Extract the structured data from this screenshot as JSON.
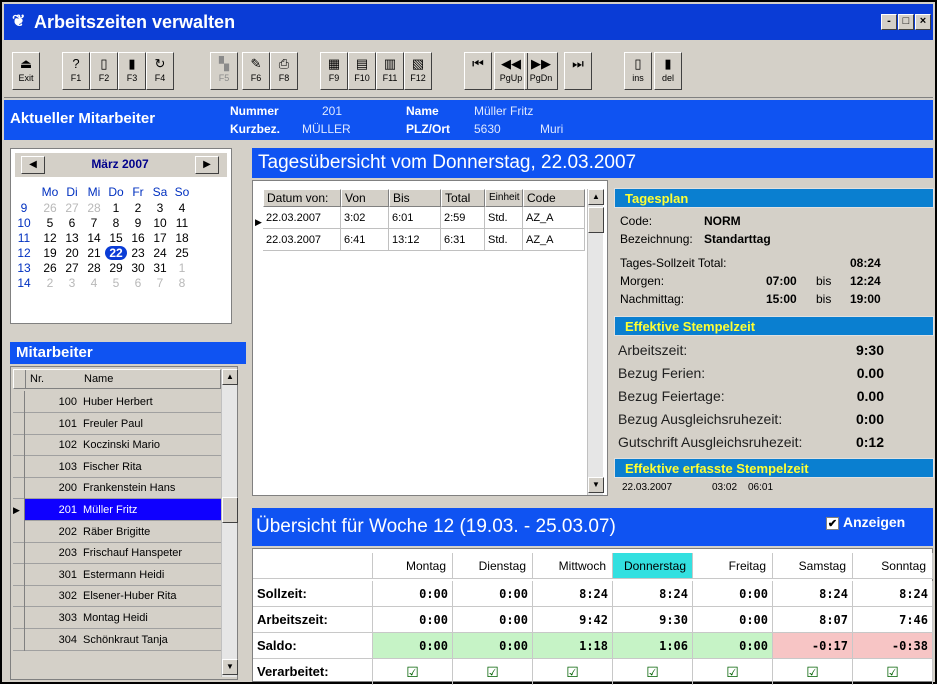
{
  "window": {
    "title": "Arbeitszeiten verwalten",
    "controls": [
      "-",
      "□",
      "×"
    ]
  },
  "toolbar": [
    {
      "icon": "exit-icon",
      "glyph": "⏏",
      "label": "Exit",
      "enabled": true
    },
    {
      "icon": "help-icon",
      "glyph": "?",
      "label": "F1",
      "enabled": true
    },
    {
      "icon": "new-icon",
      "glyph": "▯",
      "label": "F2",
      "enabled": true
    },
    {
      "icon": "delete-icon",
      "glyph": "▮",
      "label": "F3",
      "enabled": true
    },
    {
      "icon": "refresh-icon",
      "glyph": "↻",
      "label": "F4",
      "enabled": true
    },
    {
      "icon": "disabled-icon",
      "glyph": "▚",
      "label": "F5",
      "enabled": false
    },
    {
      "icon": "edit-icon",
      "glyph": "✎",
      "label": "F6",
      "enabled": true
    },
    {
      "icon": "print-icon",
      "glyph": "⎙",
      "label": "F8",
      "enabled": true
    },
    {
      "icon": "calendar-icon",
      "glyph": "▦",
      "label": "F9",
      "enabled": true
    },
    {
      "icon": "report-icon",
      "glyph": "▤",
      "label": "F10",
      "enabled": true
    },
    {
      "icon": "list-icon",
      "glyph": "▥",
      "label": "F11",
      "enabled": true
    },
    {
      "icon": "export-icon",
      "glyph": "▧",
      "label": "F12",
      "enabled": true
    },
    {
      "icon": "first-icon",
      "glyph": "⏮",
      "label": "",
      "enabled": true
    },
    {
      "icon": "prev-icon",
      "glyph": "◀◀",
      "label": "PgUp",
      "enabled": true
    },
    {
      "icon": "next-icon",
      "glyph": "▶▶",
      "label": "PgDn",
      "enabled": true
    },
    {
      "icon": "last-icon",
      "glyph": "⏭",
      "label": "",
      "enabled": true
    },
    {
      "icon": "insert-icon",
      "glyph": "▯",
      "label": "ins",
      "enabled": true
    },
    {
      "icon": "trash-icon",
      "glyph": "▮",
      "label": "del",
      "enabled": true
    }
  ],
  "employee_bar": {
    "title": "Aktueller Mitarbeiter",
    "nummer_label": "Nummer",
    "nummer_value": "201",
    "name_label": "Name",
    "name_value": "Müller Fritz",
    "kurzbez_label": "Kurzbez.",
    "kurzbez_value": "MÜLLER",
    "plz_label": "PLZ/Ort",
    "plz_value": "5630",
    "ort_value": "Muri"
  },
  "calendar": {
    "month": "März 2007",
    "prev": "◀",
    "next": "▶",
    "weekday_headers": [
      "Mo",
      "Di",
      "Mi",
      "Do",
      "Fr",
      "Sa",
      "So"
    ],
    "weeks": [
      {
        "wk": "9",
        "days": [
          "26",
          "27",
          "28",
          "1",
          "2",
          "3",
          "4"
        ]
      },
      {
        "wk": "10",
        "days": [
          "5",
          "6",
          "7",
          "8",
          "9",
          "10",
          "11"
        ]
      },
      {
        "wk": "11",
        "days": [
          "12",
          "13",
          "14",
          "15",
          "16",
          "17",
          "18"
        ]
      },
      {
        "wk": "12",
        "days": [
          "19",
          "20",
          "21",
          "22",
          "23",
          "24",
          "25"
        ]
      },
      {
        "wk": "13",
        "days": [
          "26",
          "27",
          "28",
          "29",
          "30",
          "31",
          "1"
        ]
      },
      {
        "wk": "14",
        "days": [
          "2",
          "3",
          "4",
          "5",
          "6",
          "7",
          "8"
        ]
      }
    ],
    "selected_day": "22"
  },
  "mitarbeiter": {
    "title": "Mitarbeiter",
    "col_nr": "Nr.",
    "col_name": "Name",
    "rows": [
      {
        "nr": "100",
        "name": "Huber Herbert"
      },
      {
        "nr": "101",
        "name": "Freuler Paul"
      },
      {
        "nr": "102",
        "name": "Koczinski Mario"
      },
      {
        "nr": "103",
        "name": "Fischer Rita"
      },
      {
        "nr": "200",
        "name": "Frankenstein Hans"
      },
      {
        "nr": "201",
        "name": "Müller Fritz"
      },
      {
        "nr": "202",
        "name": "Räber Brigitte"
      },
      {
        "nr": "203",
        "name": "Frischauf Hanspeter"
      },
      {
        "nr": "301",
        "name": "Estermann Heidi"
      },
      {
        "nr": "302",
        "name": "Elsener-Huber Rita"
      },
      {
        "nr": "303",
        "name": "Montag Heidi"
      },
      {
        "nr": "304",
        "name": "Schönkraut Tanja"
      }
    ],
    "selected_nr": "201"
  },
  "tagesuebersicht": {
    "title": "Tagesübersicht vom Donnerstag, 22.03.2007",
    "columns": [
      "Datum von:",
      "Von",
      "Bis",
      "Total",
      "Einheit",
      "Code"
    ],
    "rows": [
      [
        "22.03.2007",
        "3:02",
        "6:01",
        "2:59",
        "Std.",
        "AZ_A"
      ],
      [
        "22.03.2007",
        "6:41",
        "13:12",
        "6:31",
        "Std.",
        "AZ_A"
      ]
    ]
  },
  "tagesplan": {
    "title": "Tagesplan",
    "code_label": "Code:",
    "code_value": "NORM",
    "bez_label": "Bezeichnung:",
    "bez_value": "Standarttag",
    "soll_label": "Tages-Sollzeit Total:",
    "soll_value": "08:24",
    "morgen_label": "Morgen:",
    "morgen_from": "07:00",
    "morgen_bis": "bis",
    "morgen_to": "12:24",
    "nachm_label": "Nachmittag:",
    "nachm_from": "15:00",
    "nachm_bis": "bis",
    "nachm_to": "19:00"
  },
  "effektiv": {
    "title": "Effektive Stempelzeit",
    "rows": [
      {
        "label": "Arbeitszeit:",
        "value": "9:30"
      },
      {
        "label": "Bezug Ferien:",
        "value": "0.00"
      },
      {
        "label": "Bezug Feiertage:",
        "value": "0.00"
      },
      {
        "label": "Bezug Ausgleichsruhezeit:",
        "value": "0:00"
      },
      {
        "label": "Gutschrift Ausgleichsruhezeit:",
        "value": "0:12"
      }
    ]
  },
  "erfasst": {
    "title": "Effektive erfasste Stempelzeit",
    "date": "22.03.2007",
    "from": "03:02",
    "to": "06:01"
  },
  "woche": {
    "title": "Übersicht für Woche 12 (19.03. - 25.03.07)",
    "anzeigen_label": "Anzeigen",
    "anzeigen_checked": "✔",
    "days": [
      "Montag",
      "Dienstag",
      "Mittwoch",
      "Donnerstag",
      "Freitag",
      "Samstag",
      "Sonntag"
    ],
    "rows": [
      {
        "label": "Sollzeit:",
        "values": [
          "0:00",
          "0:00",
          "8:24",
          "8:24",
          "0:00",
          "8:24",
          "8:24"
        ]
      },
      {
        "label": "Arbeitszeit:",
        "values": [
          "0:00",
          "0:00",
          "9:42",
          "9:30",
          "0:00",
          "8:07",
          "7:46"
        ]
      },
      {
        "label": "Saldo:",
        "values": [
          "0:00",
          "0:00",
          "1:18",
          "1:06",
          "0:00",
          "-0:17",
          "-0:38"
        ]
      }
    ],
    "verarbeitet_label": "Verarbeitet:",
    "check": "☑",
    "saldo_colors": {
      "positive": "#c6f3c6",
      "negative": "#f7c5c5"
    }
  }
}
